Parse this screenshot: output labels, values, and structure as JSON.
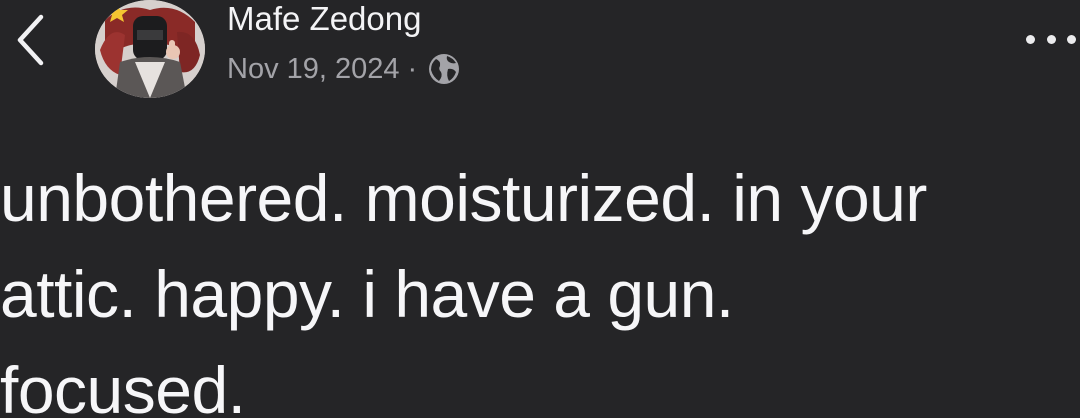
{
  "post": {
    "author": {
      "name": "Mafe Zedong",
      "avatar": "avatar-image"
    },
    "date": "Nov 19, 2024",
    "separator": "·",
    "visibility_icon": "globe-icon",
    "text_lines": [
      "unbothered. moisturized. in your",
      "attic. happy. i have a gun.",
      "focused."
    ]
  },
  "nav": {
    "back_icon": "chevron-left-icon",
    "more_icon": "more-horizontal-icon"
  },
  "colors": {
    "background": "#252527",
    "text_primary": "#f4f4f6",
    "text_secondary": "#a3a3a8"
  }
}
